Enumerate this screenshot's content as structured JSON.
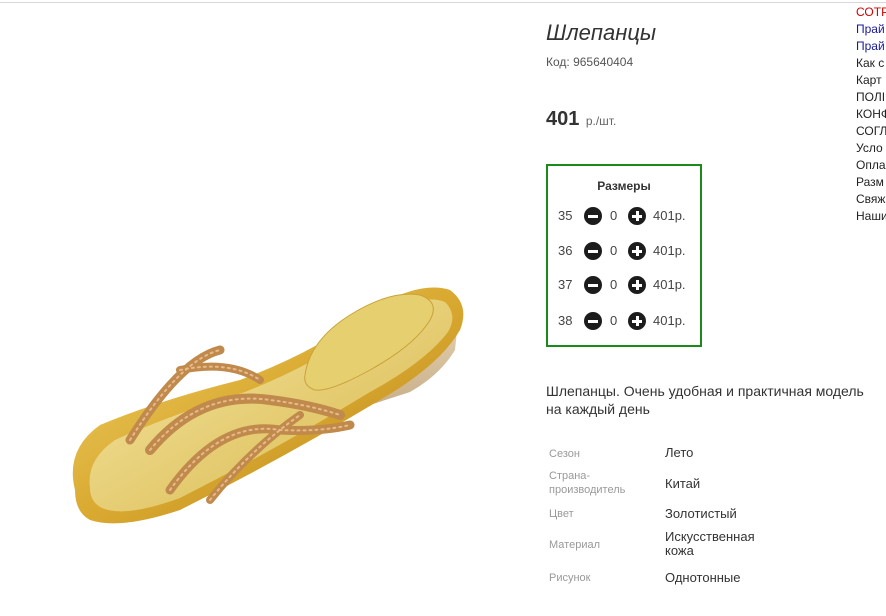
{
  "product": {
    "title": "Шлепанцы",
    "code": "Код: 965640404",
    "price_value": "401",
    "price_unit": "р./шт."
  },
  "sizes": {
    "title": "Размеры",
    "rows": [
      {
        "size": "35",
        "qty": "0",
        "price": "401р."
      },
      {
        "size": "36",
        "qty": "0",
        "price": "401р."
      },
      {
        "size": "37",
        "qty": "0",
        "price": "401р."
      },
      {
        "size": "38",
        "qty": "0",
        "price": "401р."
      }
    ]
  },
  "description": "Шлепанцы. Очень удобная и практичная модель на каждый день",
  "attributes": [
    {
      "label": "Сезон",
      "value": "Лето"
    },
    {
      "label": "Страна-производитель",
      "value": "Китай"
    },
    {
      "label": "Цвет",
      "value": "Золотистый"
    },
    {
      "label": "Материал",
      "value": "Искусственная кожа"
    },
    {
      "label": "Рисунок",
      "value": "Однотонные"
    }
  ],
  "side_links": [
    {
      "text": "СОТР",
      "color": "red"
    },
    {
      "text": "Прай",
      "color": "blue"
    },
    {
      "text": "Прай",
      "color": "blue"
    },
    {
      "text": "Как с",
      "color": "black"
    },
    {
      "text": "Карт",
      "color": "black"
    },
    {
      "text": "ПОЛІ",
      "color": "black"
    },
    {
      "text": "КОНФ",
      "color": "black"
    },
    {
      "text": "СОГЛ",
      "color": "black"
    },
    {
      "text": "Усло",
      "color": "black"
    },
    {
      "text": "Опла",
      "color": "black"
    },
    {
      "text": "Разм",
      "color": "black"
    },
    {
      "text": "Свяж",
      "color": "black"
    },
    {
      "text": "Наши",
      "color": "black"
    }
  ],
  "colors": {
    "sizes_border": "#1a8a1a",
    "link_red": "#d40000",
    "link_blue": "#1a1a9c"
  }
}
